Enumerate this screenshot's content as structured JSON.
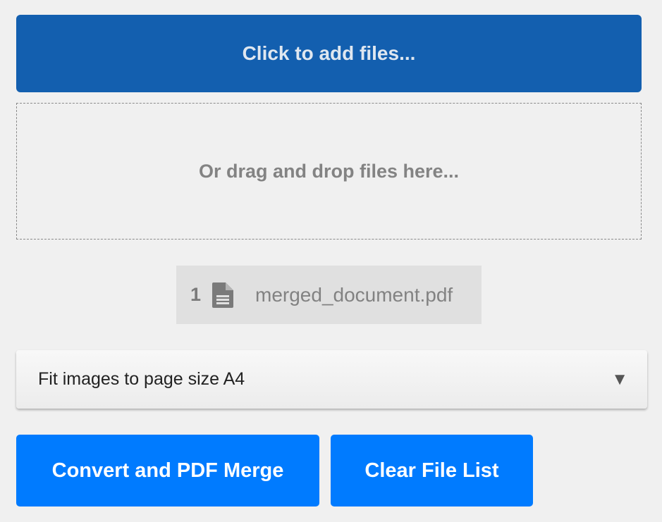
{
  "uploader": {
    "add_files_label": "Click to add files...",
    "drop_zone_label": "Or drag and drop files here..."
  },
  "files": [
    {
      "index": "1",
      "icon": "document-icon",
      "name": "merged_document.pdf"
    }
  ],
  "page_size": {
    "selected": "Fit images to page size A4",
    "arrow": "▼"
  },
  "actions": {
    "convert_label": "Convert and PDF Merge",
    "clear_label": "Clear File List"
  },
  "colors": {
    "add_files_bg": "#135faf",
    "action_bg": "#007bff",
    "file_item_bg": "#e0e0e0",
    "page_bg": "#f0f0f0"
  }
}
